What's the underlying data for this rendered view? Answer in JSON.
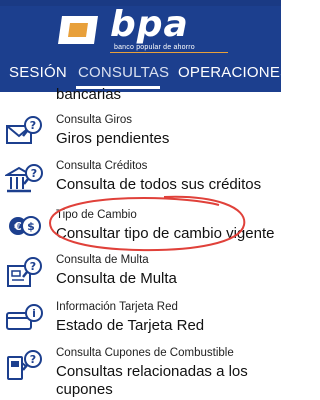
{
  "header": {
    "logo_text": "bpa",
    "logo_subtitle": "banco popular de ahorro",
    "colors": {
      "background": "#1c3f8e",
      "accent": "#e8a03a"
    }
  },
  "tabs": [
    {
      "label": "SESIÓN",
      "active": false
    },
    {
      "label": "CONSULTAS",
      "active": true
    },
    {
      "label": "OPERACIONES",
      "active": false
    }
  ],
  "partial_item": "bancarias",
  "items": [
    {
      "title": "Consulta Giros",
      "subtitle": "Giros pendientes",
      "icon": "envelope-search-icon"
    },
    {
      "title": "Consulta Créditos",
      "subtitle": "Consulta de todos sus créditos",
      "icon": "bank-search-icon"
    },
    {
      "title": "Tipo de Cambio",
      "subtitle": "Consultar tipo de cambio vigente",
      "icon": "currency-exchange-icon"
    },
    {
      "title": "Consulta de Multa",
      "subtitle": "Consulta de Multa",
      "icon": "ticket-search-icon"
    },
    {
      "title": "Información Tarjeta Red",
      "subtitle": "Estado de Tarjeta Red",
      "icon": "card-info-icon"
    },
    {
      "title": "Consulta Cupones de Combustible",
      "subtitle": "Consultas relacionadas a los",
      "subtitle2": "cupones",
      "icon": "fuel-coupon-search-icon"
    }
  ],
  "annotation_color": "#e0413a"
}
